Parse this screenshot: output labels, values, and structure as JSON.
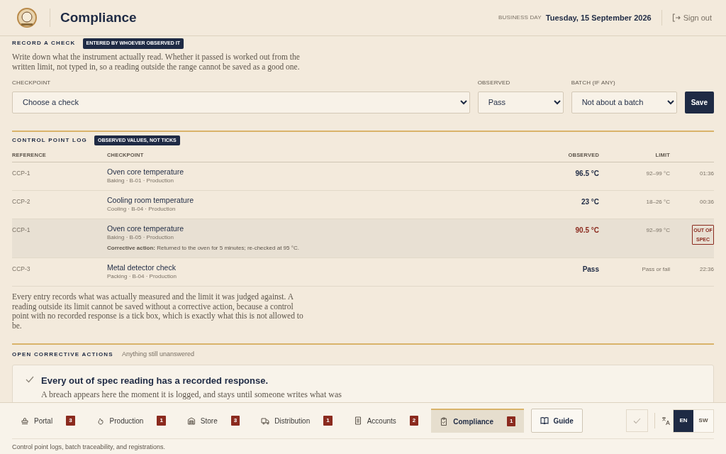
{
  "header": {
    "title": "Compliance",
    "business_day_label": "BUSINESS DAY",
    "business_day": "Tuesday, 15 September 2026",
    "sign_out": "Sign out"
  },
  "record": {
    "heading": "RECORD A CHECK",
    "badge": "ENTERED BY WHOEVER OBSERVED IT",
    "description": "Write down what the instrument actually read. Whether it passed is worked out from the written limit, not typed in, so a reading outside the range cannot be saved as a good one.",
    "fields": [
      {
        "label": "CHECKPOINT",
        "value": "Choose a check"
      },
      {
        "label": "OBSERVED",
        "value": "Pass"
      },
      {
        "label": "BATCH (IF ANY)",
        "value": "Not about a batch"
      }
    ],
    "save": "Save"
  },
  "log": {
    "heading": "CONTROL POINT LOG",
    "badge": "OBSERVED VALUES, NOT TICKS",
    "columns": [
      "REFERENCE",
      "CHECKPOINT",
      "OBSERVED",
      "LIMIT"
    ],
    "rows": [
      {
        "reference": "CCP-1",
        "checkpoint": "Oven core temperature",
        "detail": "Baking · B-01 · Production",
        "observed": "96.5 °C",
        "limit": "92–99 °C",
        "time": "01:36",
        "out_of_spec": false
      },
      {
        "reference": "CCP-2",
        "checkpoint": "Cooling room temperature",
        "detail": "Cooling · B-04 · Production",
        "observed": "23 °C",
        "limit": "18–26 °C",
        "time": "00:36",
        "out_of_spec": false
      },
      {
        "reference": "CCP-1",
        "checkpoint": "Oven core temperature",
        "detail": "Baking · B-05 · Production",
        "corrective_action": "**Corrective action:** Returned to the oven for 5 minutes; re-checked at 95 °C.",
        "observed": "90.5 °C",
        "limit": "92–99 °C",
        "status": "OUT OF SPEC",
        "out_of_spec": true
      },
      {
        "reference": "CCP-3",
        "checkpoint": "Metal detector check",
        "detail": "Packing · B-04 · Production",
        "observed": "Pass",
        "limit": "Pass or fail",
        "time": "22:36",
        "out_of_spec": false
      }
    ],
    "note": "Every entry records what was actually measured and the limit it was judged against. A reading outside its limit cannot be saved without a corrective action, because a control point with no recorded response is a tick box, which is exactly what this is not allowed to be."
  },
  "open_actions": {
    "heading": "OPEN CORRECTIVE ACTIONS",
    "subtitle": "Anything still unanswered",
    "message": "Every out of spec reading has a recorded response.",
    "message_body": "A breach appears here the moment it is logged, and stays until someone writes what was"
  },
  "nav": {
    "items": [
      {
        "kind": "stamp",
        "label": "Portal",
        "badge": "3",
        "selected": false
      },
      {
        "kind": "flame",
        "label": "Production",
        "badge": "1",
        "selected": false
      },
      {
        "kind": "warehouse",
        "label": "Store",
        "badge": "3",
        "selected": false
      },
      {
        "kind": "truck",
        "label": "Distribution",
        "badge": "1",
        "selected": false
      },
      {
        "kind": "document",
        "label": "Accounts",
        "badge": "2",
        "selected": false
      },
      {
        "kind": "clipboard",
        "label": "Compliance",
        "badge": "1",
        "selected": true
      }
    ],
    "guide": "Guide",
    "languages": [
      {
        "label": "EN",
        "selected": true
      },
      {
        "label": "SW",
        "selected": false
      }
    ]
  },
  "footer": "Control point logs, batch traceability, and registrations."
}
